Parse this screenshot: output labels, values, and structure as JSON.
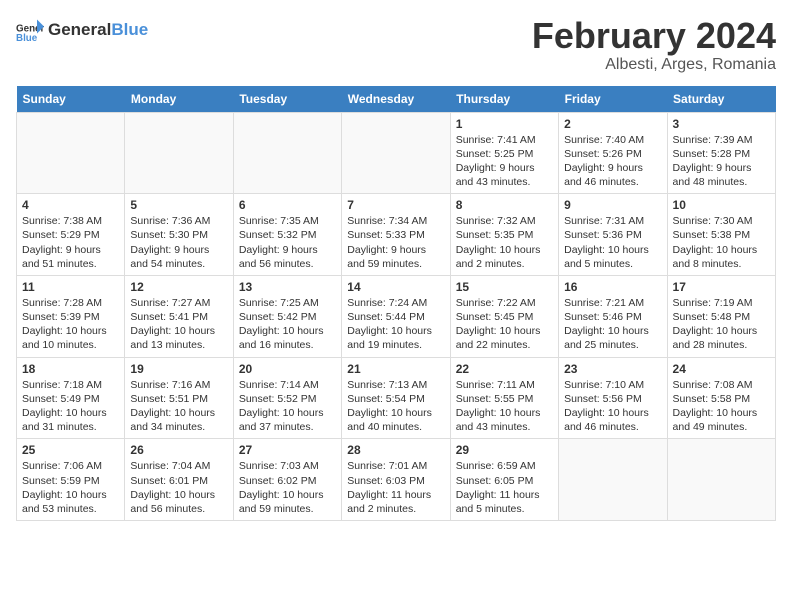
{
  "header": {
    "logo_general": "General",
    "logo_blue": "Blue",
    "main_title": "February 2024",
    "sub_title": "Albesti, Arges, Romania"
  },
  "days_of_week": [
    "Sunday",
    "Monday",
    "Tuesday",
    "Wednesday",
    "Thursday",
    "Friday",
    "Saturday"
  ],
  "weeks": [
    [
      {
        "date": "",
        "content": ""
      },
      {
        "date": "",
        "content": ""
      },
      {
        "date": "",
        "content": ""
      },
      {
        "date": "",
        "content": ""
      },
      {
        "date": "1",
        "content": "Sunrise: 7:41 AM\nSunset: 5:25 PM\nDaylight: 9 hours\nand 43 minutes."
      },
      {
        "date": "2",
        "content": "Sunrise: 7:40 AM\nSunset: 5:26 PM\nDaylight: 9 hours\nand 46 minutes."
      },
      {
        "date": "3",
        "content": "Sunrise: 7:39 AM\nSunset: 5:28 PM\nDaylight: 9 hours\nand 48 minutes."
      }
    ],
    [
      {
        "date": "4",
        "content": "Sunrise: 7:38 AM\nSunset: 5:29 PM\nDaylight: 9 hours\nand 51 minutes."
      },
      {
        "date": "5",
        "content": "Sunrise: 7:36 AM\nSunset: 5:30 PM\nDaylight: 9 hours\nand 54 minutes."
      },
      {
        "date": "6",
        "content": "Sunrise: 7:35 AM\nSunset: 5:32 PM\nDaylight: 9 hours\nand 56 minutes."
      },
      {
        "date": "7",
        "content": "Sunrise: 7:34 AM\nSunset: 5:33 PM\nDaylight: 9 hours\nand 59 minutes."
      },
      {
        "date": "8",
        "content": "Sunrise: 7:32 AM\nSunset: 5:35 PM\nDaylight: 10 hours\nand 2 minutes."
      },
      {
        "date": "9",
        "content": "Sunrise: 7:31 AM\nSunset: 5:36 PM\nDaylight: 10 hours\nand 5 minutes."
      },
      {
        "date": "10",
        "content": "Sunrise: 7:30 AM\nSunset: 5:38 PM\nDaylight: 10 hours\nand 8 minutes."
      }
    ],
    [
      {
        "date": "11",
        "content": "Sunrise: 7:28 AM\nSunset: 5:39 PM\nDaylight: 10 hours\nand 10 minutes."
      },
      {
        "date": "12",
        "content": "Sunrise: 7:27 AM\nSunset: 5:41 PM\nDaylight: 10 hours\nand 13 minutes."
      },
      {
        "date": "13",
        "content": "Sunrise: 7:25 AM\nSunset: 5:42 PM\nDaylight: 10 hours\nand 16 minutes."
      },
      {
        "date": "14",
        "content": "Sunrise: 7:24 AM\nSunset: 5:44 PM\nDaylight: 10 hours\nand 19 minutes."
      },
      {
        "date": "15",
        "content": "Sunrise: 7:22 AM\nSunset: 5:45 PM\nDaylight: 10 hours\nand 22 minutes."
      },
      {
        "date": "16",
        "content": "Sunrise: 7:21 AM\nSunset: 5:46 PM\nDaylight: 10 hours\nand 25 minutes."
      },
      {
        "date": "17",
        "content": "Sunrise: 7:19 AM\nSunset: 5:48 PM\nDaylight: 10 hours\nand 28 minutes."
      }
    ],
    [
      {
        "date": "18",
        "content": "Sunrise: 7:18 AM\nSunset: 5:49 PM\nDaylight: 10 hours\nand 31 minutes."
      },
      {
        "date": "19",
        "content": "Sunrise: 7:16 AM\nSunset: 5:51 PM\nDaylight: 10 hours\nand 34 minutes."
      },
      {
        "date": "20",
        "content": "Sunrise: 7:14 AM\nSunset: 5:52 PM\nDaylight: 10 hours\nand 37 minutes."
      },
      {
        "date": "21",
        "content": "Sunrise: 7:13 AM\nSunset: 5:54 PM\nDaylight: 10 hours\nand 40 minutes."
      },
      {
        "date": "22",
        "content": "Sunrise: 7:11 AM\nSunset: 5:55 PM\nDaylight: 10 hours\nand 43 minutes."
      },
      {
        "date": "23",
        "content": "Sunrise: 7:10 AM\nSunset: 5:56 PM\nDaylight: 10 hours\nand 46 minutes."
      },
      {
        "date": "24",
        "content": "Sunrise: 7:08 AM\nSunset: 5:58 PM\nDaylight: 10 hours\nand 49 minutes."
      }
    ],
    [
      {
        "date": "25",
        "content": "Sunrise: 7:06 AM\nSunset: 5:59 PM\nDaylight: 10 hours\nand 53 minutes."
      },
      {
        "date": "26",
        "content": "Sunrise: 7:04 AM\nSunset: 6:01 PM\nDaylight: 10 hours\nand 56 minutes."
      },
      {
        "date": "27",
        "content": "Sunrise: 7:03 AM\nSunset: 6:02 PM\nDaylight: 10 hours\nand 59 minutes."
      },
      {
        "date": "28",
        "content": "Sunrise: 7:01 AM\nSunset: 6:03 PM\nDaylight: 11 hours\nand 2 minutes."
      },
      {
        "date": "29",
        "content": "Sunrise: 6:59 AM\nSunset: 6:05 PM\nDaylight: 11 hours\nand 5 minutes."
      },
      {
        "date": "",
        "content": ""
      },
      {
        "date": "",
        "content": ""
      }
    ]
  ]
}
